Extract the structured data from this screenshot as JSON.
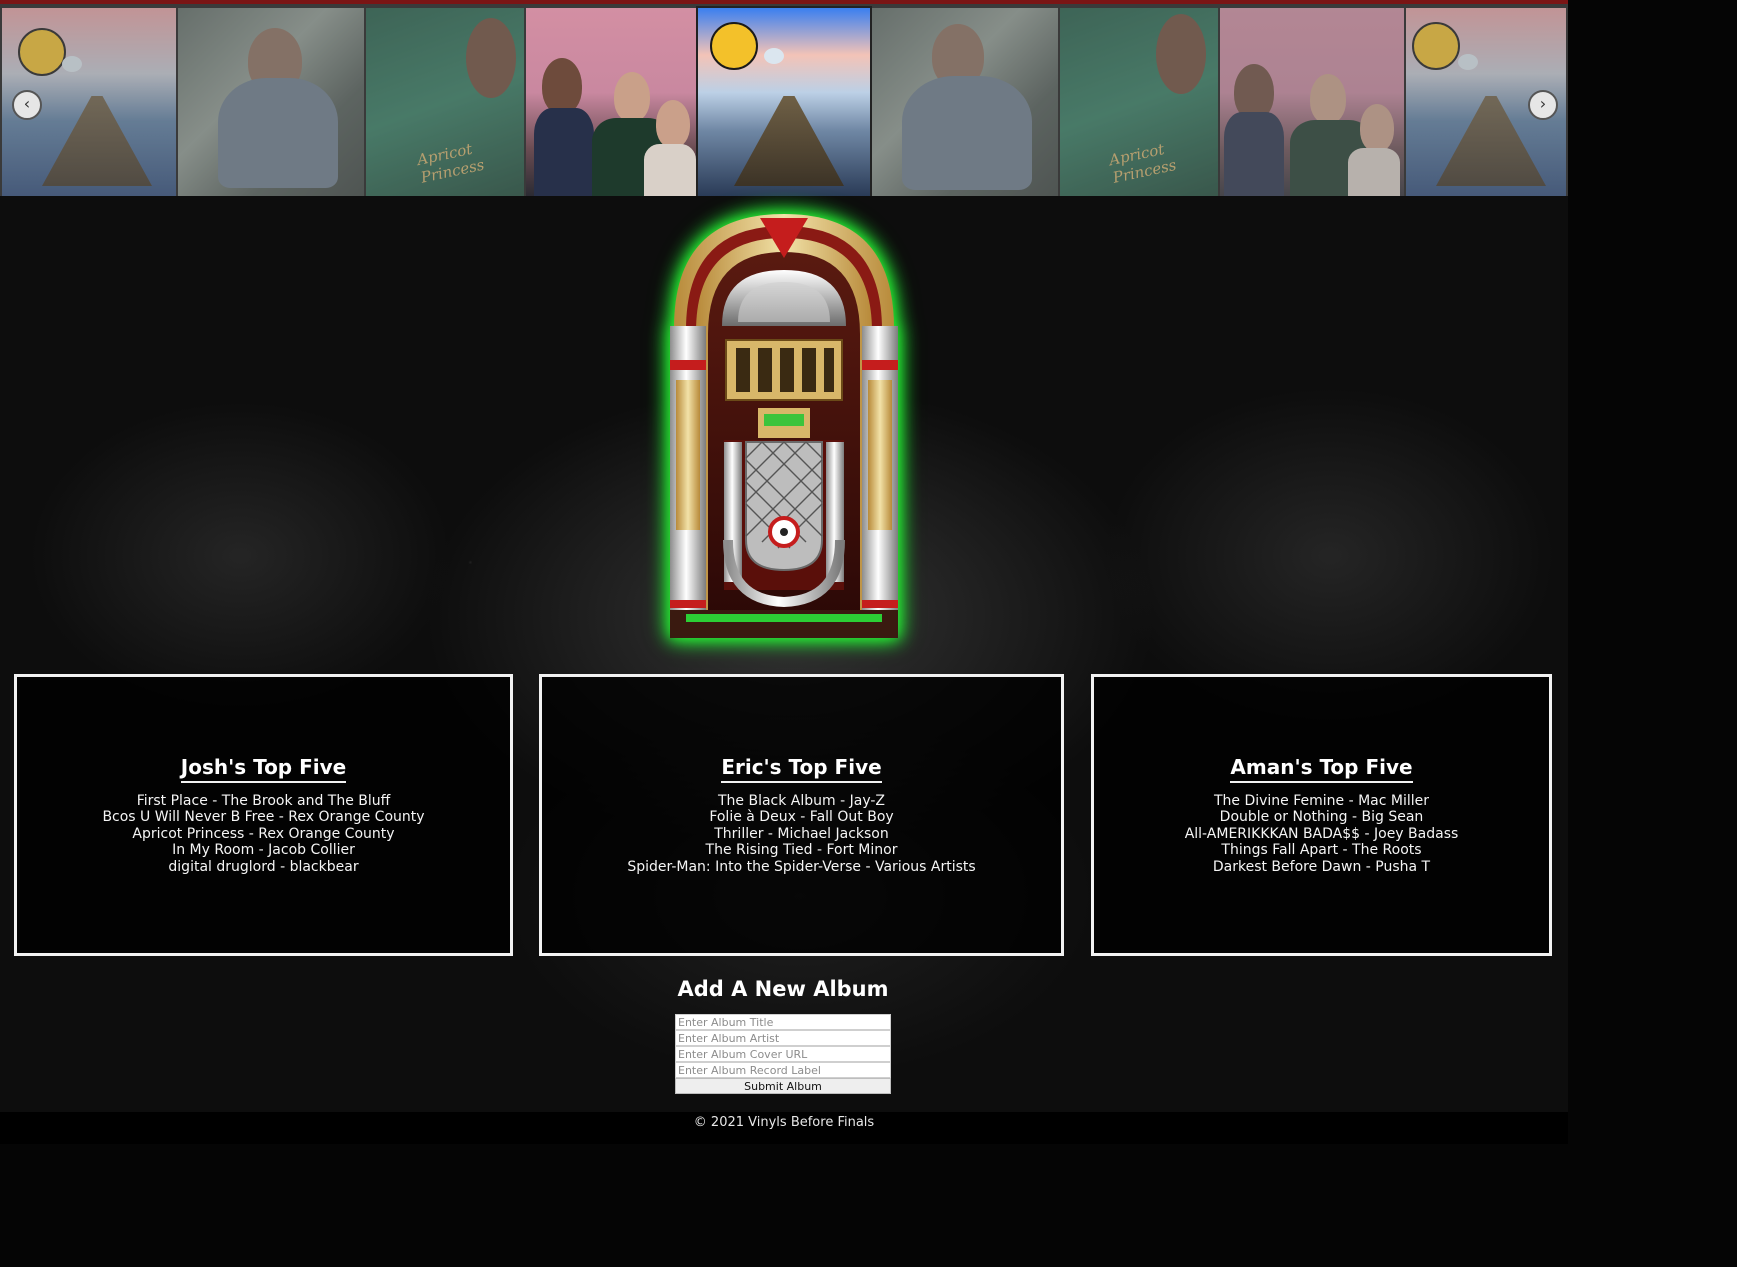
{
  "carousel": {
    "prev_icon": "‹",
    "next_icon": "›",
    "slides": [
      {
        "name": "First Place - The Brook and The Bluff",
        "cover": "brook",
        "active": false
      },
      {
        "name": "Bcos U Will Never B Free - Rex Orange County",
        "cover": "hug",
        "active": false
      },
      {
        "name": "Apricot Princess - Rex Orange County",
        "cover": "apricot",
        "active": false
      },
      {
        "name": "In My Room - Jacob Collier",
        "cover": "band",
        "active": false
      },
      {
        "name": "First Place - The Brook and The Bluff",
        "cover": "brook",
        "active": true
      },
      {
        "name": "Bcos U Will Never B Free - Rex Orange County",
        "cover": "hug",
        "active": false
      },
      {
        "name": "Apricot Princess - Rex Orange County",
        "cover": "apricot",
        "active": false
      },
      {
        "name": "In My Room - Jacob Collier",
        "cover": "band",
        "active": false
      },
      {
        "name": "First Place - The Brook and The Bluff",
        "cover": "brook",
        "active": false
      }
    ],
    "apricot_script": "Apricot Princess"
  },
  "colors": {
    "accent_red": "#7a1515",
    "glow_green": "#2cff3a"
  },
  "lists": [
    {
      "title": "Josh's Top Five",
      "items": [
        "First Place - The Brook and The Bluff",
        "Bcos U Will Never B Free - Rex Orange County",
        "Apricot Princess - Rex Orange County",
        "In My Room - Jacob Collier",
        "digital druglord - blackbear"
      ]
    },
    {
      "title": "Eric's Top Five",
      "items": [
        "The Black Album - Jay-Z",
        "Folie à Deux - Fall Out Boy",
        "Thriller - Michael Jackson",
        "The Rising Tied - Fort Minor",
        "Spider-Man: Into the Spider-Verse - Various Artists"
      ]
    },
    {
      "title": "Aman's Top Five",
      "items": [
        "The Divine Femine - Mac Miller",
        "Double or Nothing - Big Sean",
        "All-AMERIKKKAN BADA$$ - Joey Badass",
        "Things Fall Apart - The Roots",
        "Darkest Before Dawn - Pusha T"
      ]
    }
  ],
  "form": {
    "heading": "Add A New Album",
    "title_placeholder": "Enter Album Title",
    "artist_placeholder": "Enter Album Artist",
    "cover_placeholder": "Enter Album Cover URL",
    "label_placeholder": "Enter Album Record Label",
    "submit_label": "Submit Album"
  },
  "footer": {
    "text": "© 2021 Vinyls Before Finals"
  }
}
